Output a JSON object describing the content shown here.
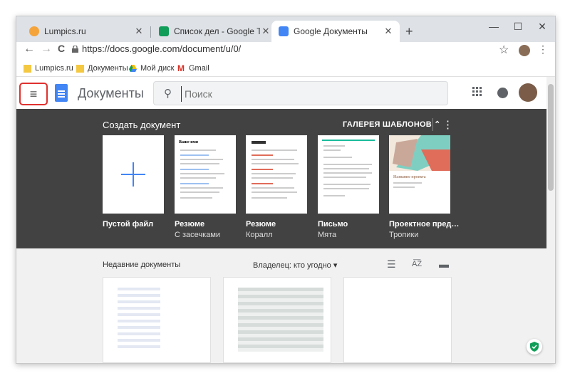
{
  "browser": {
    "tabs": [
      {
        "title": "Lumpics.ru",
        "close": "✕"
      },
      {
        "title": "Список дел - Google Таблицы",
        "close": "✕"
      },
      {
        "title": "Google Документы",
        "close": "✕"
      }
    ],
    "new_tab": "+",
    "controls": {
      "minimize": "—",
      "maximize": "☐",
      "close": "✕"
    },
    "nav": {
      "back": "←",
      "forward": "→",
      "reload": "C"
    },
    "url": "https://docs.google.com/document/u/0/",
    "star": "☆",
    "menu": "⋮",
    "bookmarks": [
      {
        "label": "Lumpics.ru",
        "icon": "folder-icon"
      },
      {
        "label": "Документы",
        "icon": "folder-icon"
      },
      {
        "label": "Мой диск",
        "icon": "drive-icon"
      },
      {
        "label": "Gmail",
        "icon": "gmail-icon"
      }
    ]
  },
  "app": {
    "menu_icon": "≡",
    "title": "Документы",
    "search_icon": "⚲",
    "search_placeholder": "Поиск",
    "apps_icon": "⋮⋮⋮"
  },
  "gallery": {
    "title": "Создать документ",
    "gallery_button": "ГАЛЕРЕЯ ШАБЛОНОВ ⌃",
    "more": "⋮",
    "templates": [
      {
        "name": "Пустой файл",
        "sub": ""
      },
      {
        "name": "Резюме",
        "sub": "С засечками"
      },
      {
        "name": "Резюме",
        "sub": "Коралл"
      },
      {
        "name": "Письмо",
        "sub": "Мята"
      },
      {
        "name": "Проектное пред…",
        "sub": "Тропики"
      }
    ],
    "thumb_text": {
      "resume": "Ваше имя",
      "project": "Название проекта"
    }
  },
  "recent": {
    "title": "Недавние документы",
    "owner_filter": "Владелец: кто угодно ▾",
    "icons": {
      "list": "☰",
      "sort": "A͞Z",
      "folder": "▬"
    }
  },
  "colors": {
    "accent": "#4285f4",
    "highlight": "#e0312f",
    "gallery_bg": "#424242",
    "mint": "#1abc9c",
    "tropic": "#7ecfc2"
  }
}
